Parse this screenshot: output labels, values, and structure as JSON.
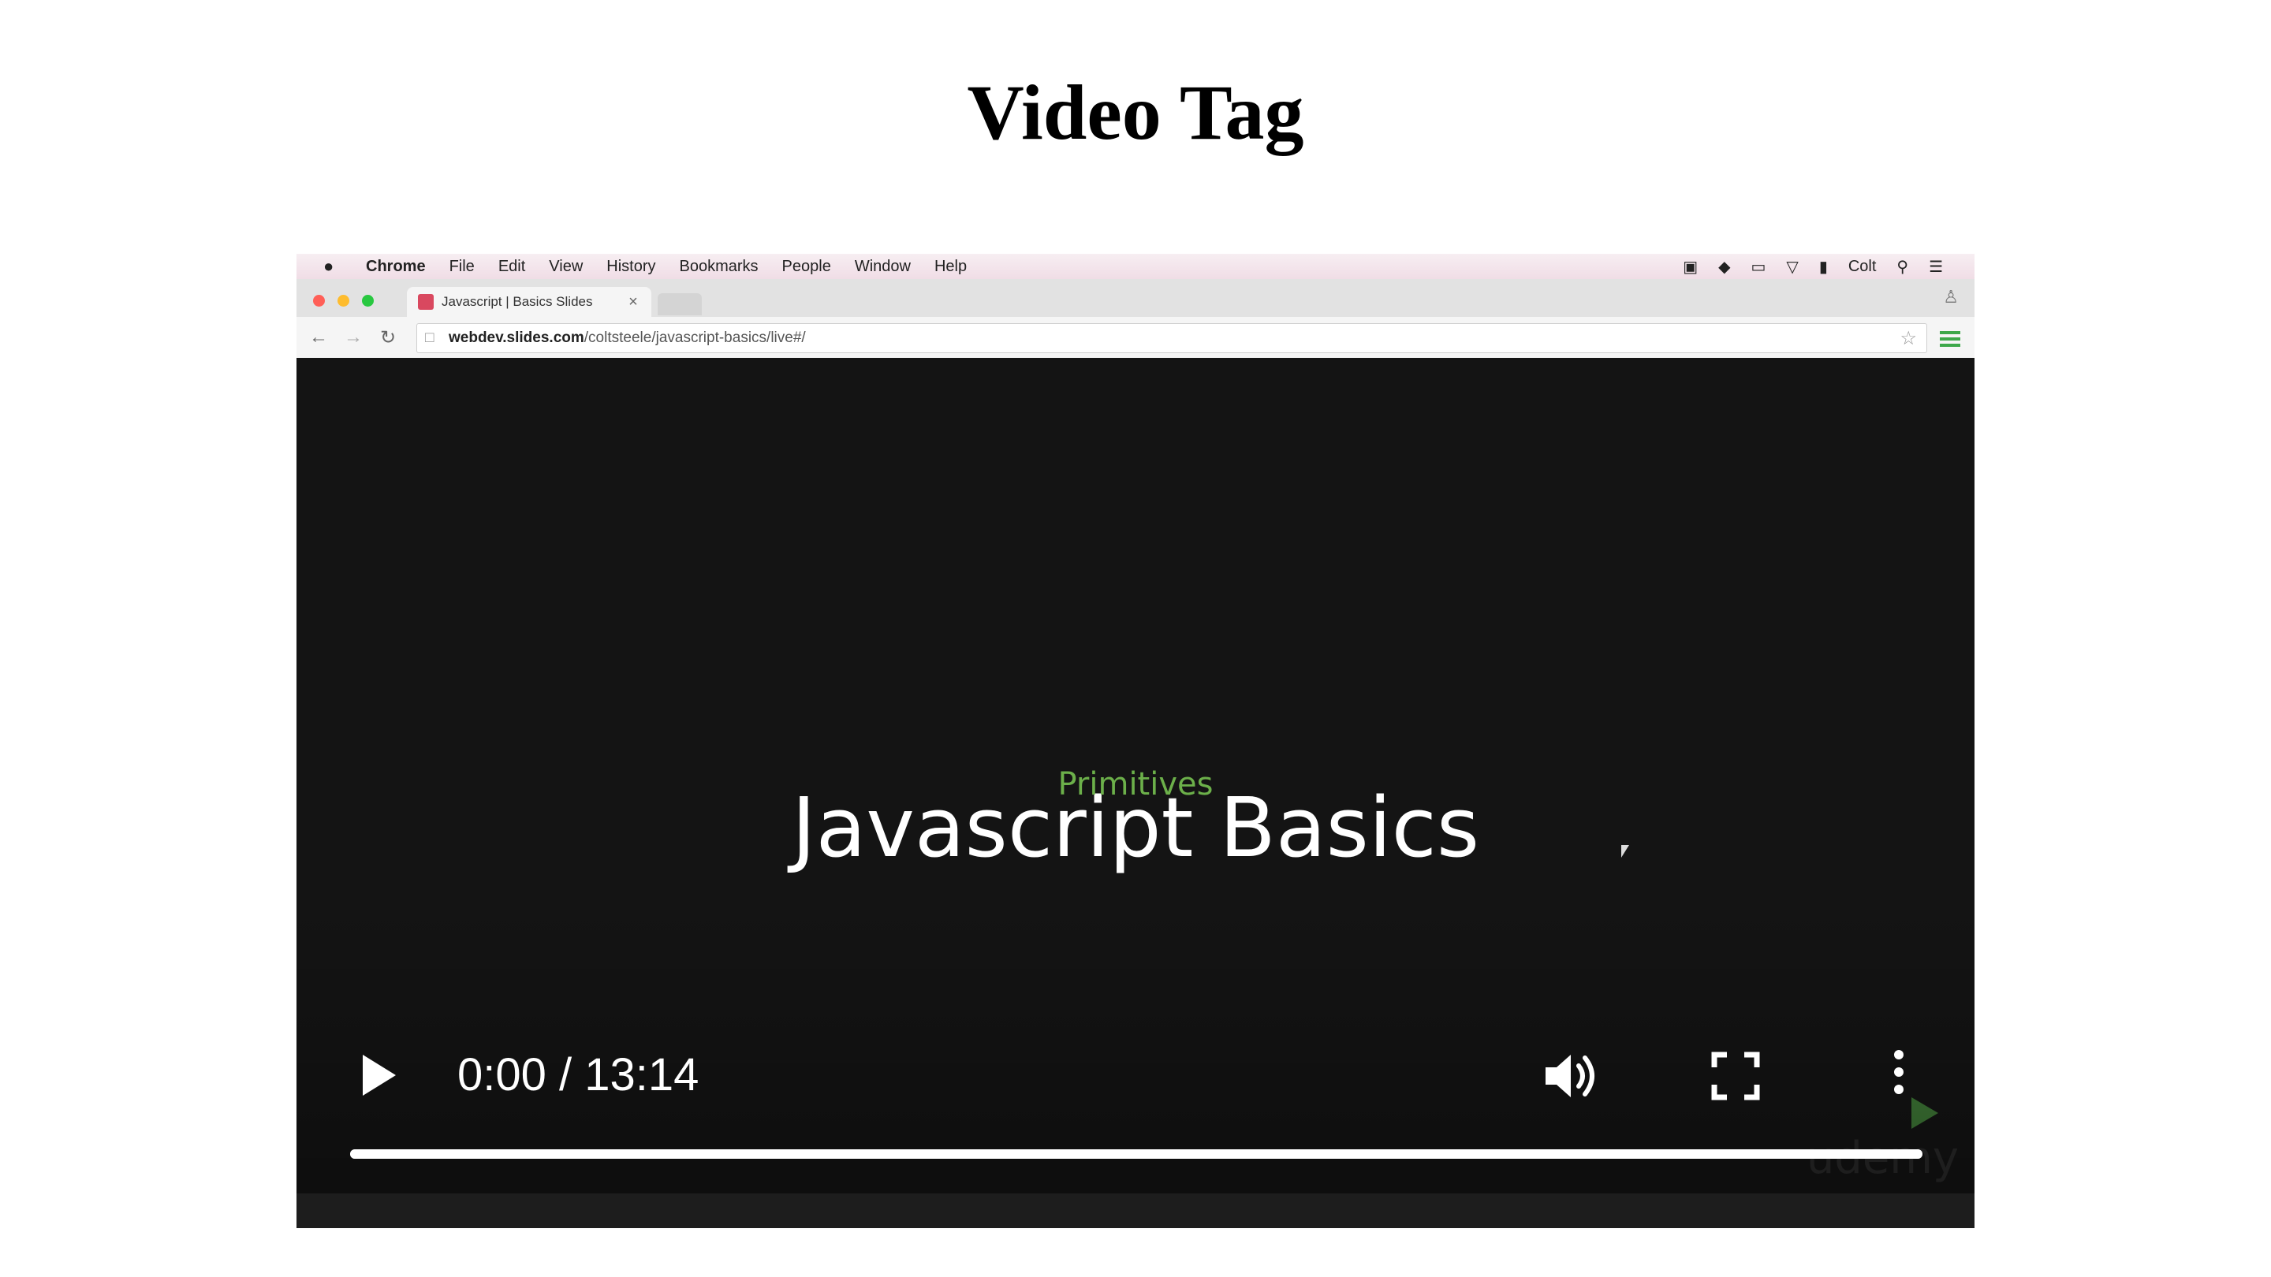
{
  "page": {
    "title": "Video Tag"
  },
  "menubar": {
    "apple_icon": "apple-icon",
    "items": [
      "Chrome",
      "File",
      "Edit",
      "View",
      "History",
      "Bookmarks",
      "People",
      "Window",
      "Help"
    ],
    "right_user": "Colt"
  },
  "browser": {
    "tab_title": "Javascript | Basics Slides",
    "url_host": "webdev.slides.com",
    "url_path": "/coltsteele/javascript-basics/live#/"
  },
  "slide": {
    "title": "Javascript Basics",
    "subtitle": "Primitives",
    "watermark": "udemy"
  },
  "video": {
    "time_display": "0:00 / 13:14",
    "progress_fraction": 1.0,
    "icons": [
      "play-icon",
      "volume-icon",
      "fullscreen-icon",
      "more-options-icon"
    ]
  },
  "colors": {
    "subtitle_green": "#6cb04a",
    "player_bg": "#141414"
  }
}
